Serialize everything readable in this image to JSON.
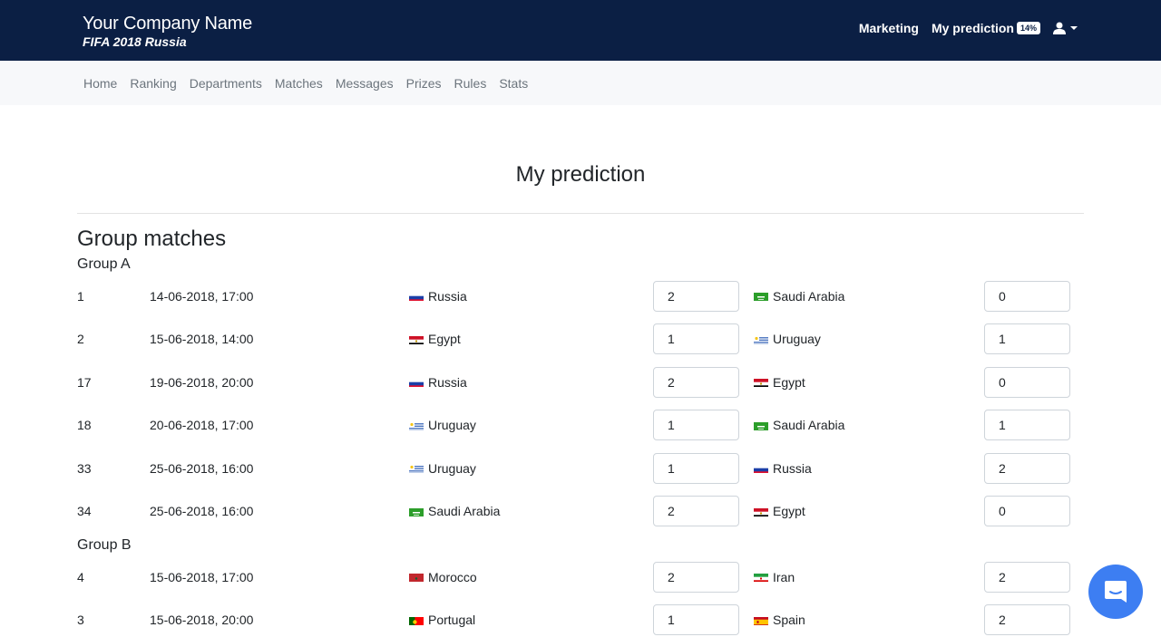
{
  "header": {
    "brand_name": "Your Company Name",
    "brand_sub": "FIFA 2018 Russia",
    "nav": {
      "marketing": "Marketing",
      "my_prediction": "My prediction",
      "progress_badge": "14%"
    },
    "user_icon": "user-icon"
  },
  "subnav": [
    "Home",
    "Ranking",
    "Departments",
    "Matches",
    "Messages",
    "Prizes",
    "Rules",
    "Stats"
  ],
  "page_title": "My prediction",
  "section_title": "Group matches",
  "groups": [
    {
      "name": "Group A",
      "matches": [
        {
          "no": "1",
          "date": "14-06-2018, 17:00",
          "home": "Russia",
          "home_flag": "russia",
          "home_score": "2",
          "away": "Saudi Arabia",
          "away_flag": "saudi",
          "away_score": "0"
        },
        {
          "no": "2",
          "date": "15-06-2018, 14:00",
          "home": "Egypt",
          "home_flag": "egypt",
          "home_score": "1",
          "away": "Uruguay",
          "away_flag": "uruguay",
          "away_score": "1"
        },
        {
          "no": "17",
          "date": "19-06-2018, 20:00",
          "home": "Russia",
          "home_flag": "russia",
          "home_score": "2",
          "away": "Egypt",
          "away_flag": "egypt",
          "away_score": "0"
        },
        {
          "no": "18",
          "date": "20-06-2018, 17:00",
          "home": "Uruguay",
          "home_flag": "uruguay",
          "home_score": "1",
          "away": "Saudi Arabia",
          "away_flag": "saudi",
          "away_score": "1"
        },
        {
          "no": "33",
          "date": "25-06-2018, 16:00",
          "home": "Uruguay",
          "home_flag": "uruguay",
          "home_score": "1",
          "away": "Russia",
          "away_flag": "russia",
          "away_score": "2"
        },
        {
          "no": "34",
          "date": "25-06-2018, 16:00",
          "home": "Saudi Arabia",
          "home_flag": "saudi",
          "home_score": "2",
          "away": "Egypt",
          "away_flag": "egypt",
          "away_score": "0"
        }
      ]
    },
    {
      "name": "Group B",
      "matches": [
        {
          "no": "4",
          "date": "15-06-2018, 17:00",
          "home": "Morocco",
          "home_flag": "morocco",
          "home_score": "2",
          "away": "Iran",
          "away_flag": "iran",
          "away_score": "2"
        },
        {
          "no": "3",
          "date": "15-06-2018, 20:00",
          "home": "Portugal",
          "home_flag": "portugal",
          "home_score": "1",
          "away": "Spain",
          "away_flag": "spain",
          "away_score": "2"
        }
      ]
    }
  ],
  "chat_widget": "chat-icon"
}
